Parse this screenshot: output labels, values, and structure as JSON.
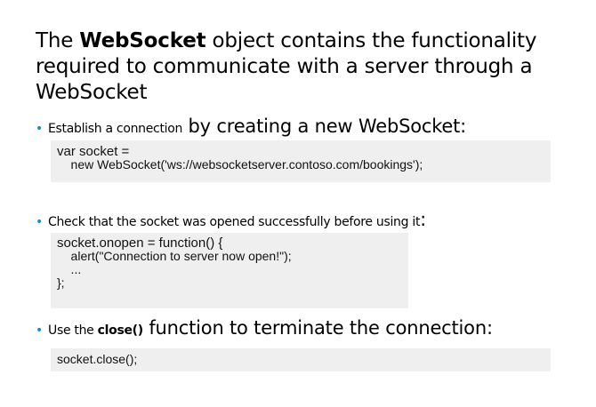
{
  "title": {
    "part1": "The ",
    "bold": "WebSocket",
    "part2": " object contains the functionality required to communicate with a server through a WebSocket"
  },
  "bullets": [
    {
      "small": "Establish a connection",
      "large": " by creating a new WebSocket:"
    },
    {
      "small": "Check that the socket was opened successfully before using it",
      "large": ":"
    },
    {
      "pre": "Use the ",
      "bold": "close()",
      "large": " function to terminate the connection:"
    }
  ],
  "code_blocks": [
    {
      "lines": [
        "var socket =",
        "    new WebSocket('ws://websocketserver.contoso.com/bookings');"
      ]
    },
    {
      "lines": [
        "socket.onopen = function() {",
        "    alert(\"Connection to server now open!\");",
        "    ...",
        "};"
      ]
    },
    {
      "lines": [
        "socket.close();"
      ]
    }
  ],
  "colors": {
    "bullet": "#0a8fd6",
    "code_background": "#efefef"
  }
}
